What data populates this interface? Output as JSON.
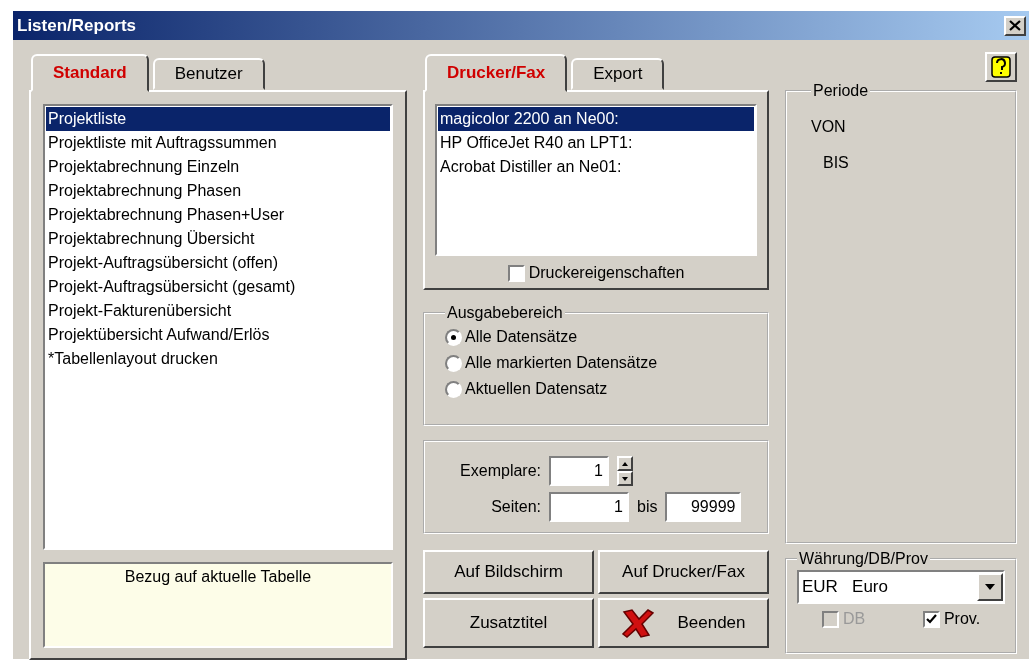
{
  "window": {
    "title": "Listen/Reports"
  },
  "report_tabs": [
    {
      "label": "Standard",
      "selected": true
    },
    {
      "label": "Benutzer",
      "selected": false
    }
  ],
  "reports": [
    {
      "label": "Projektliste",
      "selected": true
    },
    {
      "label": "Projektliste mit Auftragssummen",
      "selected": false
    },
    {
      "label": "Projektabrechnung Einzeln",
      "selected": false
    },
    {
      "label": "Projektabrechnung Phasen",
      "selected": false
    },
    {
      "label": "Projektabrechnung Phasen+User",
      "selected": false
    },
    {
      "label": "Projektabrechnung Übersicht",
      "selected": false
    },
    {
      "label": "Projekt-Auftragsübersicht (offen)",
      "selected": false
    },
    {
      "label": "Projekt-Auftragsübersicht (gesamt)",
      "selected": false
    },
    {
      "label": "Projekt-Fakturenübersicht",
      "selected": false
    },
    {
      "label": "Projektübersicht Aufwand/Erlös",
      "selected": false
    },
    {
      "label": "*Tabellenlayout drucken",
      "selected": false
    }
  ],
  "note": "Bezug auf aktuelle Tabelle",
  "output_tabs": [
    {
      "label": "Drucker/Fax",
      "selected": true
    },
    {
      "label": "Export",
      "selected": false
    }
  ],
  "printers": [
    {
      "label": "magicolor 2200 an Ne00:",
      "selected": true
    },
    {
      "label": "HP OfficeJet R40 an LPT1:",
      "selected": false
    },
    {
      "label": "Acrobat Distiller an Ne01:",
      "selected": false
    }
  ],
  "printer_properties": {
    "label": "Druckereigenschaften",
    "checked": false
  },
  "range": {
    "title": "Ausgabebereich",
    "options": [
      {
        "label": "Alle Datensätze",
        "selected": true
      },
      {
        "label": "Alle markierten Datensätze",
        "selected": false
      },
      {
        "label": "Aktuellen Datensatz",
        "selected": false
      }
    ]
  },
  "copies": {
    "label": "Exemplare:",
    "value": "1"
  },
  "pages": {
    "label": "Seiten:",
    "from": "1",
    "to_label": "bis",
    "to": "99999"
  },
  "buttons": [
    {
      "label": "Auf Bildschirm",
      "kind": "plain"
    },
    {
      "label": "Auf Drucker/Fax",
      "kind": "plain"
    },
    {
      "label": "Zusatztitel",
      "kind": "plain"
    },
    {
      "label": "Beenden",
      "kind": "exit"
    }
  ],
  "period": {
    "title": "Periode",
    "from_label": "VON",
    "to_label": "BIS"
  },
  "currency": {
    "title": "Währung/DB/Prov",
    "value": "EUR   Euro",
    "options": [
      {
        "label": "DB",
        "checked": false,
        "disabled": true
      },
      {
        "label": "Prov.",
        "checked": true,
        "disabled": false
      }
    ]
  }
}
